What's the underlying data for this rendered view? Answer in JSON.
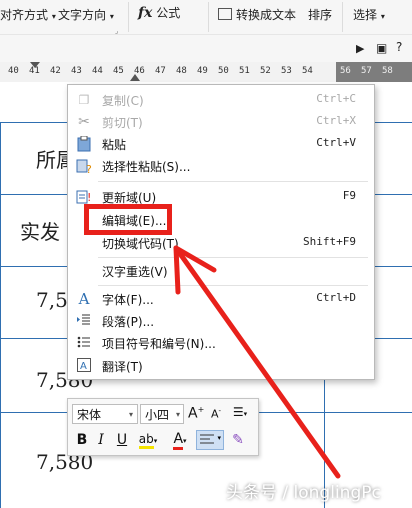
{
  "ribbon": {
    "align_label": "对齐方式",
    "text_direction_label": "文字方向",
    "fx_label": "fx",
    "formula_label": "公式",
    "convert_text_label": "转换成文本",
    "sort_label": "排序",
    "select_label": "选择"
  },
  "ruler": {
    "numbers_left": [
      "40",
      "41",
      "42",
      "43",
      "44",
      "45",
      "46",
      "47",
      "48",
      "49",
      "50",
      "51",
      "52",
      "53",
      "54"
    ],
    "numbers_right": [
      "56",
      "57",
      "58"
    ]
  },
  "document": {
    "cell_1": "所属",
    "cell_2": "实发",
    "value_1": "7,580",
    "value_2": "7,580",
    "value_3": "7,580"
  },
  "context_menu": {
    "items": [
      {
        "label": "复制(C)",
        "shortcut": "Ctrl+C",
        "icon": "copy-icon",
        "disabled": true
      },
      {
        "label": "剪切(T)",
        "shortcut": "Ctrl+X",
        "icon": "scissors-icon",
        "disabled": true
      },
      {
        "label": "粘贴",
        "shortcut": "Ctrl+V",
        "icon": "paste-icon",
        "disabled": false
      },
      {
        "label": "选择性粘贴(S)...",
        "shortcut": "",
        "icon": "paste-special-icon",
        "disabled": false
      },
      {
        "label": "更新域(U)",
        "shortcut": "F9",
        "icon": "update-field-icon",
        "disabled": false
      },
      {
        "label": "编辑域(E)...",
        "shortcut": "",
        "icon": "",
        "disabled": false
      },
      {
        "label": "切换域代码(T)",
        "shortcut": "Shift+F9",
        "icon": "",
        "disabled": false
      },
      {
        "label": "汉字重选(V)",
        "shortcut": "",
        "icon": "",
        "disabled": false
      },
      {
        "label": "字体(F)...",
        "shortcut": "Ctrl+D",
        "icon": "font-icon",
        "disabled": false
      },
      {
        "label": "段落(P)...",
        "shortcut": "",
        "icon": "paragraph-icon",
        "disabled": false
      },
      {
        "label": "项目符号和编号(N)...",
        "shortcut": "",
        "icon": "bullets-icon",
        "disabled": false
      },
      {
        "label": "翻译(T)",
        "shortcut": "",
        "icon": "translate-icon",
        "disabled": false
      }
    ]
  },
  "mini_toolbar": {
    "font_name": "宋体",
    "font_size": "小四",
    "bold": "B",
    "italic": "I",
    "underline": "U",
    "font_color_letter": "A",
    "highlight_letters": "ab",
    "grow_letter": "A",
    "shrink_letter": "A"
  },
  "watermark": "头条号 / longlingPc",
  "colors": {
    "annotation_red": "#e8211b",
    "table_border": "#2f6fb1",
    "ribbon_bg": "#f6f6f6"
  }
}
